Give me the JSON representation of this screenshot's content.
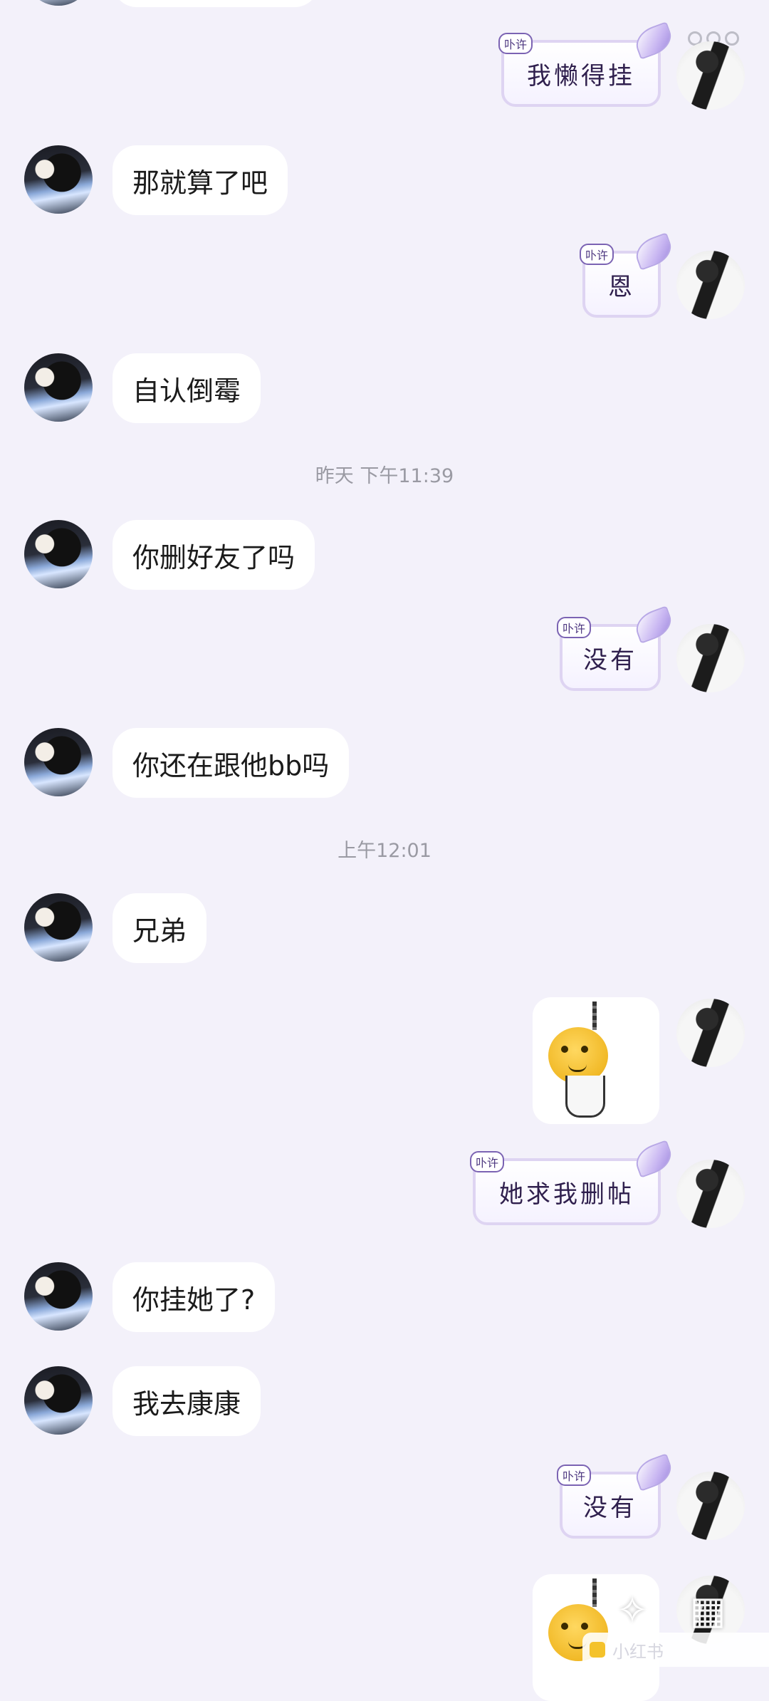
{
  "messages": {
    "m1": {
      "sender": "me",
      "text": "我懒得挂",
      "tag": "卟许"
    },
    "m2": {
      "sender": "friend",
      "text": "那就算了吧"
    },
    "m3": {
      "sender": "me",
      "text": "恩",
      "tag": "卟许"
    },
    "m4": {
      "sender": "friend",
      "text": "自认倒霉"
    },
    "t1": "昨天 下午11:39",
    "m5": {
      "sender": "friend",
      "text": "你删好友了吗"
    },
    "m6": {
      "sender": "me",
      "text": "没有",
      "tag": "卟许"
    },
    "m7": {
      "sender": "friend",
      "text": "你还在跟他bb吗"
    },
    "t2": "上午12:01",
    "m8": {
      "sender": "friend",
      "text": "兄弟"
    },
    "m9": {
      "sender": "me",
      "sticker": "hanging-smiley-sticker"
    },
    "m10": {
      "sender": "me",
      "text": "她求我删帖",
      "tag": "卟许"
    },
    "m11": {
      "sender": "friend",
      "text": "你挂她了?"
    },
    "m12": {
      "sender": "friend",
      "text": "我去康康"
    },
    "m13": {
      "sender": "me",
      "text": "没有",
      "tag": "卟许"
    },
    "m14": {
      "sender": "me",
      "sticker": "hanging-smiley-sticker"
    }
  },
  "overlay": {
    "tools": [
      "magic-wand-icon",
      "grid-icon"
    ],
    "watermark": "小红书"
  },
  "colors": {
    "background": "#f3f1fa",
    "bubble": "#ffffff",
    "deco_border": "#ded4f2",
    "timestamp": "#9a9aa3"
  }
}
